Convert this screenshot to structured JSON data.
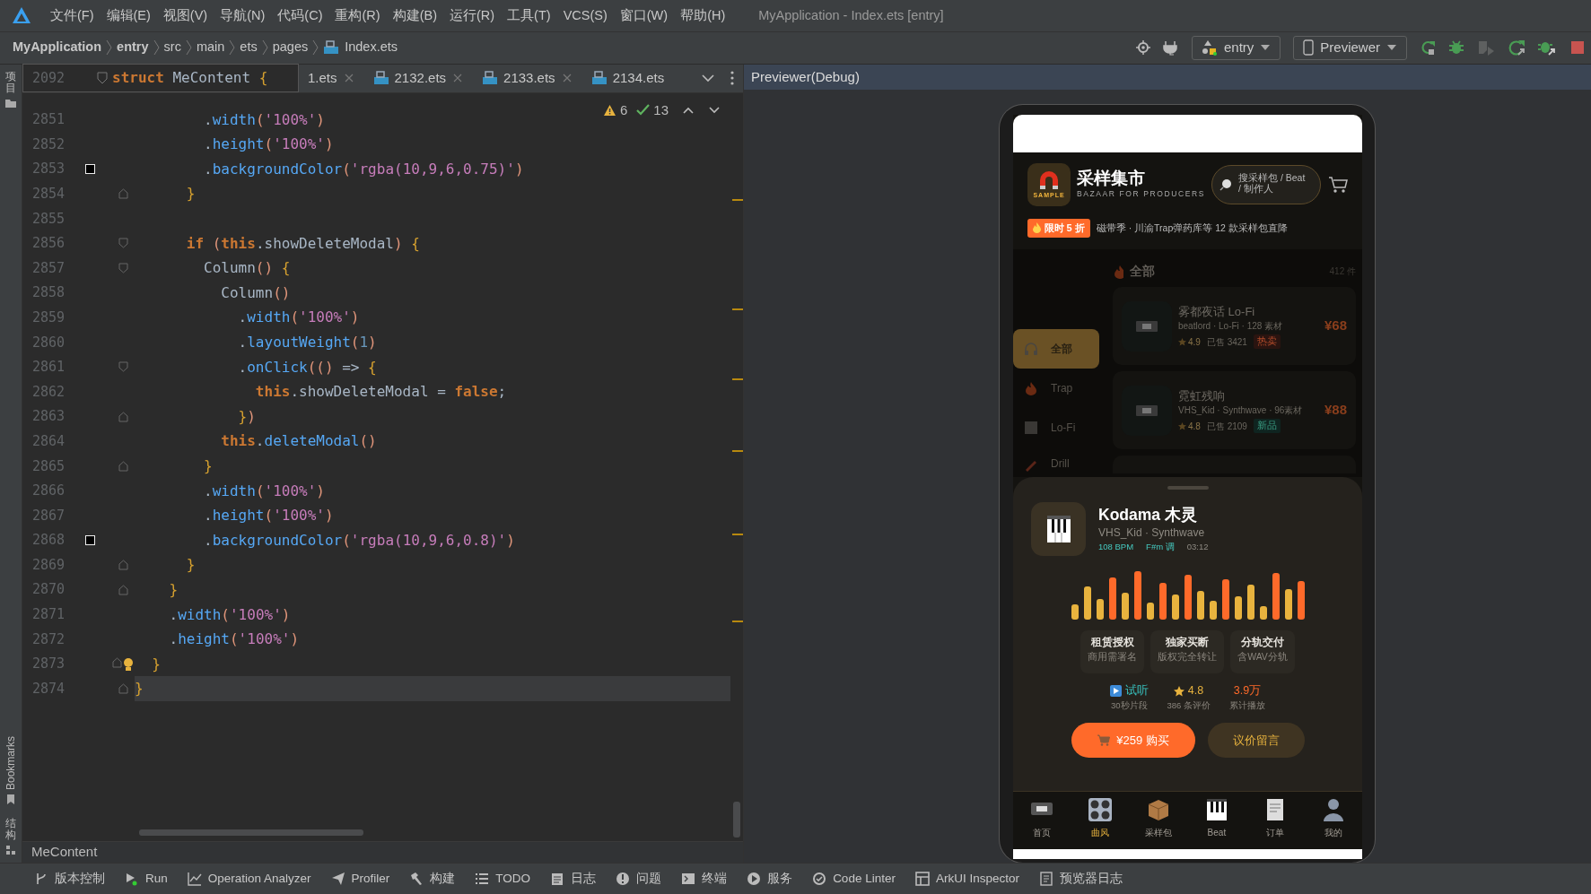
{
  "menu_bar": {
    "items": [
      "文件(F)",
      "编辑(E)",
      "视图(V)",
      "导航(N)",
      "代码(C)",
      "重构(R)",
      "构建(B)",
      "运行(R)",
      "工具(T)",
      "VCS(S)",
      "窗口(W)",
      "帮助(H)"
    ],
    "title": "MyApplication - Index.ets [entry]"
  },
  "nav_bar": {
    "breadcrumb": [
      {
        "label": "MyApplication",
        "kind": "project"
      },
      {
        "label": "entry",
        "kind": "module"
      },
      {
        "label": "src",
        "kind": "folder"
      },
      {
        "label": "main",
        "kind": "folder"
      },
      {
        "label": "ets",
        "kind": "folder"
      },
      {
        "label": "pages",
        "kind": "folder"
      },
      {
        "label": "Index.ets",
        "kind": "file"
      }
    ],
    "run_config": "entry",
    "device": "Previewer"
  },
  "side_strip": {
    "project": "项目",
    "bookmarks": "Bookmarks",
    "structure": "结构"
  },
  "editor": {
    "sticky": {
      "number": "2092",
      "code": "**struct** MeContent {"
    },
    "tabs": [
      {
        "label": "1.ets",
        "selected": false
      },
      {
        "label": "2132.ets",
        "selected": false
      },
      {
        "label": "2133.ets",
        "selected": false
      },
      {
        "label": "2134.ets",
        "selected": false
      }
    ],
    "inspections": {
      "warnings": "6",
      "passed": "13"
    },
    "lines": [
      {
        "number": "2851",
        "kind": "plain",
        "code": "        .width('100%')"
      },
      {
        "number": "2852",
        "kind": "plain",
        "code": "        .height('100%')"
      },
      {
        "number": "2853",
        "kind": "plain",
        "swatch": true,
        "code": "        .backgroundColor('rgba(10,9,6,0.75)')"
      },
      {
        "number": "2854",
        "kind": "fold_end",
        "code": "      }"
      },
      {
        "number": "2855",
        "kind": "plain"
      },
      {
        "number": "2856",
        "kind": "fold_start",
        "code": "      **if** (**this**.showDeleteModal) {"
      },
      {
        "number": "2857",
        "kind": "fold_start",
        "code": "        Column() {"
      },
      {
        "number": "2858",
        "kind": "plain",
        "code": "          Column()"
      },
      {
        "number": "2859",
        "kind": "plain",
        "code": "            .width('100%')"
      },
      {
        "number": "2860",
        "kind": "plain",
        "code": "            .layoutWeight(1)"
      },
      {
        "number": "2861",
        "kind": "fold_start",
        "code": "            .onClick(() => {"
      },
      {
        "number": "2862",
        "kind": "plain",
        "code": "              **this**.showDeleteModal = **false**;"
      },
      {
        "number": "2863",
        "kind": "fold_end",
        "code": "            })"
      },
      {
        "number": "2864",
        "kind": "plain",
        "code": "          **this**.deleteModal()"
      },
      {
        "number": "2865",
        "kind": "fold_end",
        "code": "        }"
      },
      {
        "number": "2866",
        "kind": "plain",
        "code": "        .width('100%')"
      },
      {
        "number": "2867",
        "kind": "plain",
        "code": "        .height('100%')"
      },
      {
        "number": "2868",
        "kind": "plain",
        "swatch": true,
        "code": "        .backgroundColor('rgba(10,9,6,0.8)')"
      },
      {
        "number": "2869",
        "kind": "fold_end",
        "code": "      }"
      },
      {
        "number": "2870",
        "kind": "fold_end",
        "code": "    }"
      },
      {
        "number": "2871",
        "kind": "plain",
        "code": "    .width('100%')"
      },
      {
        "number": "2872",
        "kind": "plain",
        "code": "    .height('100%')"
      },
      {
        "number": "2873",
        "kind": "fold_end",
        "bulb": true,
        "code": "  }"
      },
      {
        "number": "2874",
        "kind": "fold_end",
        "current": true,
        "code": "}"
      }
    ],
    "breadcrumb": "MeContent"
  },
  "previewer": {
    "title": "Previewer(Debug)",
    "app": {
      "logo_text": "SAMPLE",
      "title": "采样集市",
      "subtitle": "BAZAAR FOR PRODUCERS",
      "search_placeholder": "搜采样包 / Beat / 制作人",
      "promo": {
        "badge": "限时 5 折",
        "text": "磁带季 · 川渝Trap弹药库等 12 款采样包直降"
      },
      "categories": [
        {
          "label": "全部",
          "selected": true
        },
        {
          "label": "Trap",
          "selected": false
        },
        {
          "label": "Lo-Fi",
          "selected": false
        },
        {
          "label": "Drill",
          "selected": false
        }
      ],
      "list_title": "全部",
      "count": "412 件",
      "products": [
        {
          "name": "雾都夜话 Lo-Fi",
          "meta": "beatlord · Lo-Fi · 128 素材",
          "rating": "4.9",
          "sold": "已售 3421",
          "tag": "热卖",
          "kind": "hot",
          "price": "¥68"
        },
        {
          "name": "霓虹残响",
          "meta": "VHS_Kid · Synthwave · 96素材",
          "rating": "4.8",
          "sold": "已售 2109",
          "tag": "新品",
          "kind": "new",
          "price": "¥88"
        }
      ],
      "sheet": {
        "title": "Kodama 木灵",
        "subtitle": "VHS_Kid · Synthwave",
        "bpm": "108 BPM",
        "key": "F#m 调",
        "duration": "03:12",
        "options": [
          {
            "title": "租赁授权",
            "note": "商用需署名"
          },
          {
            "title": "独家买断",
            "note": "版权完全转让"
          },
          {
            "title": "分轨交付",
            "note": "含WAV分轨"
          }
        ],
        "stats": [
          {
            "kind": "preview",
            "value": "试听",
            "label": "30秒片段"
          },
          {
            "kind": "rating",
            "value": "4.8",
            "label": "386 条评价"
          },
          {
            "kind": "plays",
            "value": "3.9万",
            "label": "累计播放"
          }
        ],
        "buy": "¥259 购买",
        "negotiate": "议价留言"
      },
      "nav": [
        {
          "label": "首页",
          "selected": false
        },
        {
          "label": "曲风",
          "selected": true
        },
        {
          "label": "采样包",
          "selected": false
        },
        {
          "label": "Beat",
          "selected": false
        },
        {
          "label": "订单",
          "selected": false
        },
        {
          "label": "我的",
          "selected": false
        }
      ]
    }
  },
  "tool_bar": [
    "版本控制",
    "Run",
    "Operation Analyzer",
    "Profiler",
    "构建",
    "TODO",
    "日志",
    "问题",
    "终端",
    "服务",
    "Code Linter",
    "ArkUI Inspector",
    "预览器日志"
  ]
}
